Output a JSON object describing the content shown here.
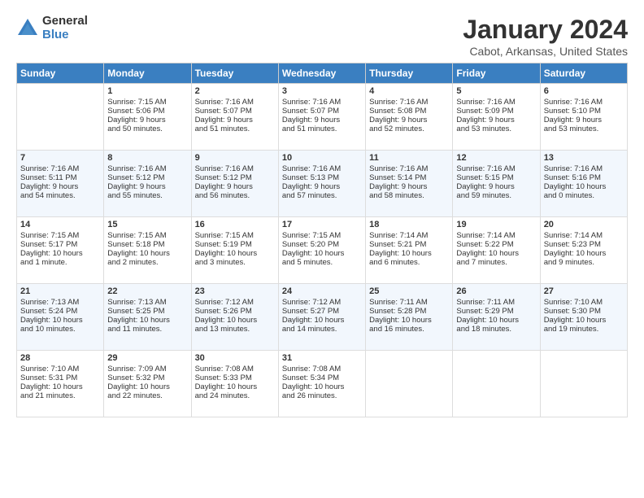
{
  "logo": {
    "general": "General",
    "blue": "Blue"
  },
  "title": "January 2024",
  "subtitle": "Cabot, Arkansas, United States",
  "days_of_week": [
    "Sunday",
    "Monday",
    "Tuesday",
    "Wednesday",
    "Thursday",
    "Friday",
    "Saturday"
  ],
  "weeks": [
    [
      {
        "day": "",
        "data": ""
      },
      {
        "day": "1",
        "data": "Sunrise: 7:15 AM\nSunset: 5:06 PM\nDaylight: 9 hours\nand 50 minutes."
      },
      {
        "day": "2",
        "data": "Sunrise: 7:16 AM\nSunset: 5:07 PM\nDaylight: 9 hours\nand 51 minutes."
      },
      {
        "day": "3",
        "data": "Sunrise: 7:16 AM\nSunset: 5:07 PM\nDaylight: 9 hours\nand 51 minutes."
      },
      {
        "day": "4",
        "data": "Sunrise: 7:16 AM\nSunset: 5:08 PM\nDaylight: 9 hours\nand 52 minutes."
      },
      {
        "day": "5",
        "data": "Sunrise: 7:16 AM\nSunset: 5:09 PM\nDaylight: 9 hours\nand 53 minutes."
      },
      {
        "day": "6",
        "data": "Sunrise: 7:16 AM\nSunset: 5:10 PM\nDaylight: 9 hours\nand 53 minutes."
      }
    ],
    [
      {
        "day": "7",
        "data": "Sunrise: 7:16 AM\nSunset: 5:11 PM\nDaylight: 9 hours\nand 54 minutes."
      },
      {
        "day": "8",
        "data": "Sunrise: 7:16 AM\nSunset: 5:12 PM\nDaylight: 9 hours\nand 55 minutes."
      },
      {
        "day": "9",
        "data": "Sunrise: 7:16 AM\nSunset: 5:12 PM\nDaylight: 9 hours\nand 56 minutes."
      },
      {
        "day": "10",
        "data": "Sunrise: 7:16 AM\nSunset: 5:13 PM\nDaylight: 9 hours\nand 57 minutes."
      },
      {
        "day": "11",
        "data": "Sunrise: 7:16 AM\nSunset: 5:14 PM\nDaylight: 9 hours\nand 58 minutes."
      },
      {
        "day": "12",
        "data": "Sunrise: 7:16 AM\nSunset: 5:15 PM\nDaylight: 9 hours\nand 59 minutes."
      },
      {
        "day": "13",
        "data": "Sunrise: 7:16 AM\nSunset: 5:16 PM\nDaylight: 10 hours\nand 0 minutes."
      }
    ],
    [
      {
        "day": "14",
        "data": "Sunrise: 7:15 AM\nSunset: 5:17 PM\nDaylight: 10 hours\nand 1 minute."
      },
      {
        "day": "15",
        "data": "Sunrise: 7:15 AM\nSunset: 5:18 PM\nDaylight: 10 hours\nand 2 minutes."
      },
      {
        "day": "16",
        "data": "Sunrise: 7:15 AM\nSunset: 5:19 PM\nDaylight: 10 hours\nand 3 minutes."
      },
      {
        "day": "17",
        "data": "Sunrise: 7:15 AM\nSunset: 5:20 PM\nDaylight: 10 hours\nand 5 minutes."
      },
      {
        "day": "18",
        "data": "Sunrise: 7:14 AM\nSunset: 5:21 PM\nDaylight: 10 hours\nand 6 minutes."
      },
      {
        "day": "19",
        "data": "Sunrise: 7:14 AM\nSunset: 5:22 PM\nDaylight: 10 hours\nand 7 minutes."
      },
      {
        "day": "20",
        "data": "Sunrise: 7:14 AM\nSunset: 5:23 PM\nDaylight: 10 hours\nand 9 minutes."
      }
    ],
    [
      {
        "day": "21",
        "data": "Sunrise: 7:13 AM\nSunset: 5:24 PM\nDaylight: 10 hours\nand 10 minutes."
      },
      {
        "day": "22",
        "data": "Sunrise: 7:13 AM\nSunset: 5:25 PM\nDaylight: 10 hours\nand 11 minutes."
      },
      {
        "day": "23",
        "data": "Sunrise: 7:12 AM\nSunset: 5:26 PM\nDaylight: 10 hours\nand 13 minutes."
      },
      {
        "day": "24",
        "data": "Sunrise: 7:12 AM\nSunset: 5:27 PM\nDaylight: 10 hours\nand 14 minutes."
      },
      {
        "day": "25",
        "data": "Sunrise: 7:11 AM\nSunset: 5:28 PM\nDaylight: 10 hours\nand 16 minutes."
      },
      {
        "day": "26",
        "data": "Sunrise: 7:11 AM\nSunset: 5:29 PM\nDaylight: 10 hours\nand 18 minutes."
      },
      {
        "day": "27",
        "data": "Sunrise: 7:10 AM\nSunset: 5:30 PM\nDaylight: 10 hours\nand 19 minutes."
      }
    ],
    [
      {
        "day": "28",
        "data": "Sunrise: 7:10 AM\nSunset: 5:31 PM\nDaylight: 10 hours\nand 21 minutes."
      },
      {
        "day": "29",
        "data": "Sunrise: 7:09 AM\nSunset: 5:32 PM\nDaylight: 10 hours\nand 22 minutes."
      },
      {
        "day": "30",
        "data": "Sunrise: 7:08 AM\nSunset: 5:33 PM\nDaylight: 10 hours\nand 24 minutes."
      },
      {
        "day": "31",
        "data": "Sunrise: 7:08 AM\nSunset: 5:34 PM\nDaylight: 10 hours\nand 26 minutes."
      },
      {
        "day": "",
        "data": ""
      },
      {
        "day": "",
        "data": ""
      },
      {
        "day": "",
        "data": ""
      }
    ]
  ]
}
